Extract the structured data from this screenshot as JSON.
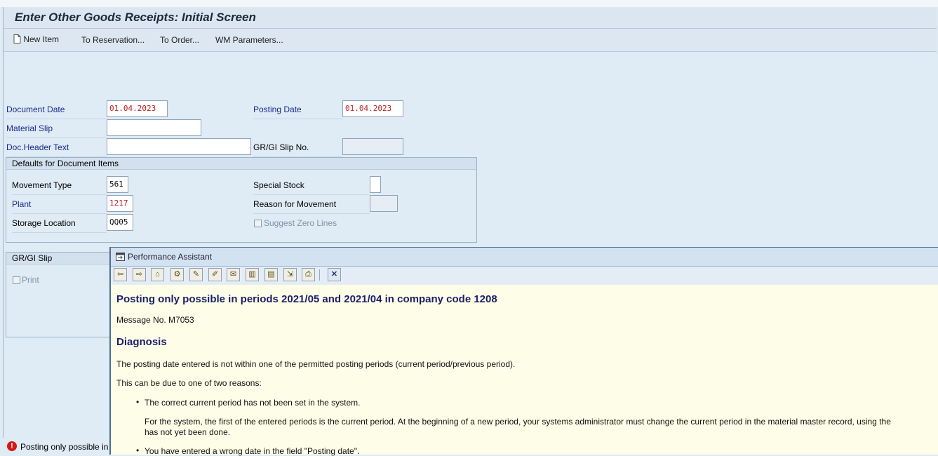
{
  "screen_title": "Enter Other Goods Receipts: Initial Screen",
  "toolbar": {
    "new_item": "New Item",
    "to_reservation": "To Reservation...",
    "to_order": "To Order...",
    "wm_parameters": "WM Parameters..."
  },
  "header_fields": {
    "document_date_label": "Document Date",
    "document_date_value": "01.04.2023",
    "posting_date_label": "Posting Date",
    "posting_date_value": "01.04.2023",
    "material_slip_label": "Material Slip",
    "material_slip_value": "",
    "doc_header_text_label": "Doc.Header Text",
    "doc_header_text_value": "",
    "gr_gi_slip_no_label": "GR/GI Slip No.",
    "gr_gi_slip_no_value": ""
  },
  "defaults_group": {
    "title": "Defaults for Document Items",
    "movement_type_label": "Movement Type",
    "movement_type_value": "561",
    "plant_label": "Plant",
    "plant_value": "1217",
    "storage_location_label": "Storage Location",
    "storage_location_value": "QQ05",
    "special_stock_label": "Special Stock",
    "special_stock_value": "",
    "reason_label": "Reason for Movement",
    "reason_value": "",
    "suggest_zero_lines_label": "Suggest Zero Lines"
  },
  "grgi_group": {
    "title": "GR/GI Slip",
    "print_label": "Print"
  },
  "status_bar": {
    "message": "Posting only possible in"
  },
  "performance_assistant": {
    "title": "Performance Assistant",
    "heading": "Posting only possible in periods 2021/05 and 2021/04 in company code 1208",
    "message_no": "Message No. M7053",
    "diagnosis_heading": "Diagnosis",
    "paragraph1": "The posting date entered is not within one of the permitted posting periods (current period/previous period).",
    "paragraph2": "This can be due to one of two reasons:",
    "bullet1": "The correct current period has not been set in the system.",
    "bullet1_detail_line1": "For the system, the first of the entered periods is the current period. At the beginning of a new period, your systems administrator must change the current period in the material master record, using the",
    "bullet1_detail_line2": "has not yet been done.",
    "bullet2": "You have entered a wrong date in the field \"Posting date\"."
  }
}
